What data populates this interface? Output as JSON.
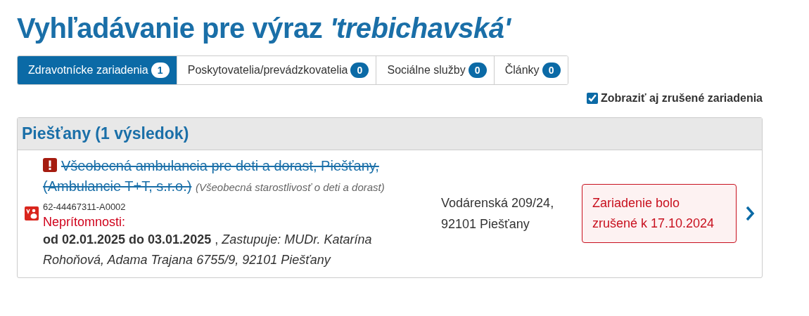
{
  "heading": "Vyhľadávanie pre výraz *'trebichavská'*",
  "tabs": [
    {
      "label": "Zdravotnícke zariadenia",
      "count": "1",
      "selected": true
    },
    {
      "label": "Poskytovatelia/prevádzkovatelia",
      "count": "0",
      "selected": false
    },
    {
      "label": "Sociálne služby",
      "count": "0",
      "selected": false
    },
    {
      "label": "Články",
      "count": "0",
      "selected": false
    }
  ],
  "show_cancelled": {
    "label": "Zobraziť aj zrušené zariadenia",
    "checked": true
  },
  "groups": [
    {
      "title": "Piešťany (1 výsledok)",
      "results": [
        {
          "name_lines": [
            "Všeobecná ambulancia pre deti a dorast, Piešťany,",
            "(Ambulancie T+T, s.r.o.)"
          ],
          "cancelled": true,
          "specialty": "(Všeobecná starostlivosť o deti a dorast)",
          "code": "62-44467311-A0002",
          "absence_label": "Neprítomnosti:",
          "absence": "**od 02.01.2025 do 03.01.2025** , *Zastupuje: MUDr. Katarína Rohoňová, Adama Trajana 6755/9, 92101 Piešťany*",
          "address": "Vodárenská 209/24, 92101 Piešťany",
          "notice": "Zariadenie bolo zrušené k 17.10.2024"
        }
      ]
    }
  ]
}
